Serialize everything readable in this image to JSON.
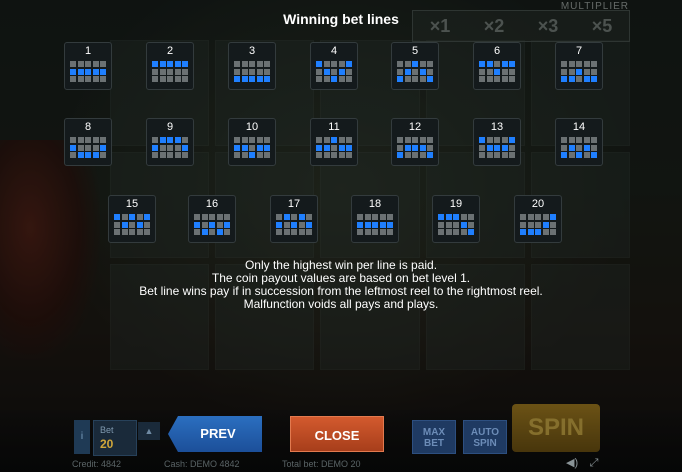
{
  "title": "Winning bet lines",
  "multiplier": {
    "label": "MULTIPLIER",
    "values": [
      "×1",
      "×2",
      "×3",
      "×5"
    ]
  },
  "lines": [
    {
      "num": "1",
      "pattern": [
        [
          0,
          0,
          0,
          0,
          0
        ],
        [
          1,
          1,
          1,
          1,
          1
        ],
        [
          0,
          0,
          0,
          0,
          0
        ]
      ]
    },
    {
      "num": "2",
      "pattern": [
        [
          1,
          1,
          1,
          1,
          1
        ],
        [
          0,
          0,
          0,
          0,
          0
        ],
        [
          0,
          0,
          0,
          0,
          0
        ]
      ]
    },
    {
      "num": "3",
      "pattern": [
        [
          0,
          0,
          0,
          0,
          0
        ],
        [
          0,
          0,
          0,
          0,
          0
        ],
        [
          1,
          1,
          1,
          1,
          1
        ]
      ]
    },
    {
      "num": "4",
      "pattern": [
        [
          1,
          0,
          0,
          0,
          1
        ],
        [
          0,
          1,
          0,
          1,
          0
        ],
        [
          0,
          0,
          1,
          0,
          0
        ]
      ]
    },
    {
      "num": "5",
      "pattern": [
        [
          0,
          0,
          1,
          0,
          0
        ],
        [
          0,
          1,
          0,
          1,
          0
        ],
        [
          1,
          0,
          0,
          0,
          1
        ]
      ]
    },
    {
      "num": "6",
      "pattern": [
        [
          1,
          1,
          0,
          1,
          1
        ],
        [
          0,
          0,
          1,
          0,
          0
        ],
        [
          0,
          0,
          0,
          0,
          0
        ]
      ]
    },
    {
      "num": "7",
      "pattern": [
        [
          0,
          0,
          0,
          0,
          0
        ],
        [
          0,
          0,
          1,
          0,
          0
        ],
        [
          1,
          1,
          0,
          1,
          1
        ]
      ]
    },
    {
      "num": "8",
      "pattern": [
        [
          0,
          0,
          0,
          0,
          0
        ],
        [
          1,
          0,
          0,
          0,
          1
        ],
        [
          0,
          1,
          1,
          1,
          0
        ]
      ]
    },
    {
      "num": "9",
      "pattern": [
        [
          0,
          1,
          1,
          1,
          0
        ],
        [
          1,
          0,
          0,
          0,
          1
        ],
        [
          0,
          0,
          0,
          0,
          0
        ]
      ]
    },
    {
      "num": "10",
      "pattern": [
        [
          0,
          0,
          0,
          0,
          0
        ],
        [
          1,
          1,
          0,
          1,
          1
        ],
        [
          0,
          0,
          1,
          0,
          0
        ]
      ]
    },
    {
      "num": "11",
      "pattern": [
        [
          0,
          0,
          1,
          0,
          0
        ],
        [
          1,
          1,
          0,
          1,
          1
        ],
        [
          0,
          0,
          0,
          0,
          0
        ]
      ]
    },
    {
      "num": "12",
      "pattern": [
        [
          0,
          0,
          0,
          0,
          0
        ],
        [
          0,
          1,
          1,
          1,
          0
        ],
        [
          1,
          0,
          0,
          0,
          1
        ]
      ]
    },
    {
      "num": "13",
      "pattern": [
        [
          1,
          0,
          0,
          0,
          1
        ],
        [
          0,
          1,
          1,
          1,
          0
        ],
        [
          0,
          0,
          0,
          0,
          0
        ]
      ]
    },
    {
      "num": "14",
      "pattern": [
        [
          0,
          0,
          0,
          0,
          0
        ],
        [
          0,
          1,
          0,
          1,
          0
        ],
        [
          1,
          0,
          1,
          0,
          1
        ]
      ]
    },
    {
      "num": "15",
      "pattern": [
        [
          1,
          0,
          1,
          0,
          1
        ],
        [
          0,
          1,
          0,
          1,
          0
        ],
        [
          0,
          0,
          0,
          0,
          0
        ]
      ]
    },
    {
      "num": "16",
      "pattern": [
        [
          0,
          0,
          0,
          0,
          0
        ],
        [
          1,
          0,
          1,
          0,
          1
        ],
        [
          0,
          1,
          0,
          1,
          0
        ]
      ]
    },
    {
      "num": "17",
      "pattern": [
        [
          0,
          1,
          0,
          1,
          0
        ],
        [
          1,
          0,
          1,
          0,
          1
        ],
        [
          0,
          0,
          0,
          0,
          0
        ]
      ]
    },
    {
      "num": "18",
      "pattern": [
        [
          0,
          0,
          0,
          0,
          0
        ],
        [
          1,
          1,
          1,
          1,
          1
        ],
        [
          0,
          0,
          0,
          0,
          0
        ]
      ]
    },
    {
      "num": "19",
      "pattern": [
        [
          1,
          1,
          1,
          0,
          0
        ],
        [
          0,
          0,
          0,
          1,
          0
        ],
        [
          0,
          0,
          0,
          0,
          1
        ]
      ]
    },
    {
      "num": "20",
      "pattern": [
        [
          0,
          0,
          0,
          0,
          1
        ],
        [
          0,
          0,
          0,
          1,
          0
        ],
        [
          1,
          1,
          1,
          0,
          0
        ]
      ]
    }
  ],
  "info": [
    "Only the highest win per line is paid.",
    "The coin payout values are based on bet level 1.",
    "Bet line wins pay if in succession from the leftmost reel to the rightmost reel.",
    "Malfunction voids all pays and plays."
  ],
  "controls": {
    "info_label": "i",
    "bet_label": "Bet",
    "bet_value": "20",
    "prev_label": "PREV",
    "close_label": "CLOSE",
    "max_bet_label": "MAX BET",
    "auto_spin_label": "AUTO SPIN",
    "spin_label": "SPIN"
  },
  "footer": {
    "credit": "Credit: 4842",
    "cash": "Cash: DEMO 4842",
    "total_bet": "Total bet: DEMO 20"
  },
  "colors": {
    "active_cell": "#1f7fff",
    "inactive_cell": "#6b7173",
    "prev_button": "#2b6fc0",
    "close_button": "#d35a2e"
  }
}
